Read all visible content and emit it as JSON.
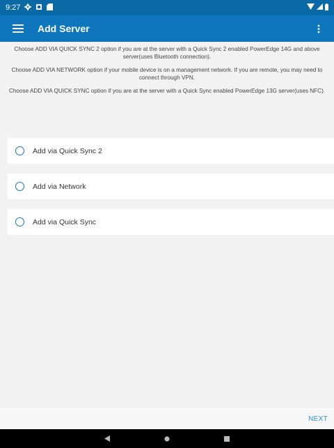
{
  "status_bar": {
    "time": "9:27",
    "left_icons": [
      "settings-icon",
      "notification-icon",
      "sd-card-icon"
    ],
    "right_icons": [
      "wifi-icon",
      "signal-icon",
      "battery-icon"
    ]
  },
  "app_bar": {
    "title": "Add Server",
    "color": "#0d76bd",
    "menu_icon": "hamburger-icon",
    "overflow_icon": "more-vert-icon"
  },
  "instructions": [
    "Choose ADD VIA QUICK SYNC 2 option if you are at the server with a Quick Sync 2 enabled PowerEdge 14G and above server(uses Bluetooth connection).",
    "Choose ADD VIA NETWORK option if your mobile device is on a management network. If you are remote, you may need to connect through VPN.",
    "Choose ADD VIA QUICK SYNC option if you are at the server with a Quick Sync enabled PowerEdge 13G server(uses NFC)."
  ],
  "options": [
    {
      "label": "Add via Quick Sync 2",
      "selected": false
    },
    {
      "label": "Add via Network",
      "selected": false
    },
    {
      "label": "Add via Quick Sync",
      "selected": false
    }
  ],
  "footer": {
    "next_label": "NEXT"
  },
  "nav_bar": {
    "icons": [
      "back-icon",
      "home-icon",
      "recents-icon"
    ]
  }
}
